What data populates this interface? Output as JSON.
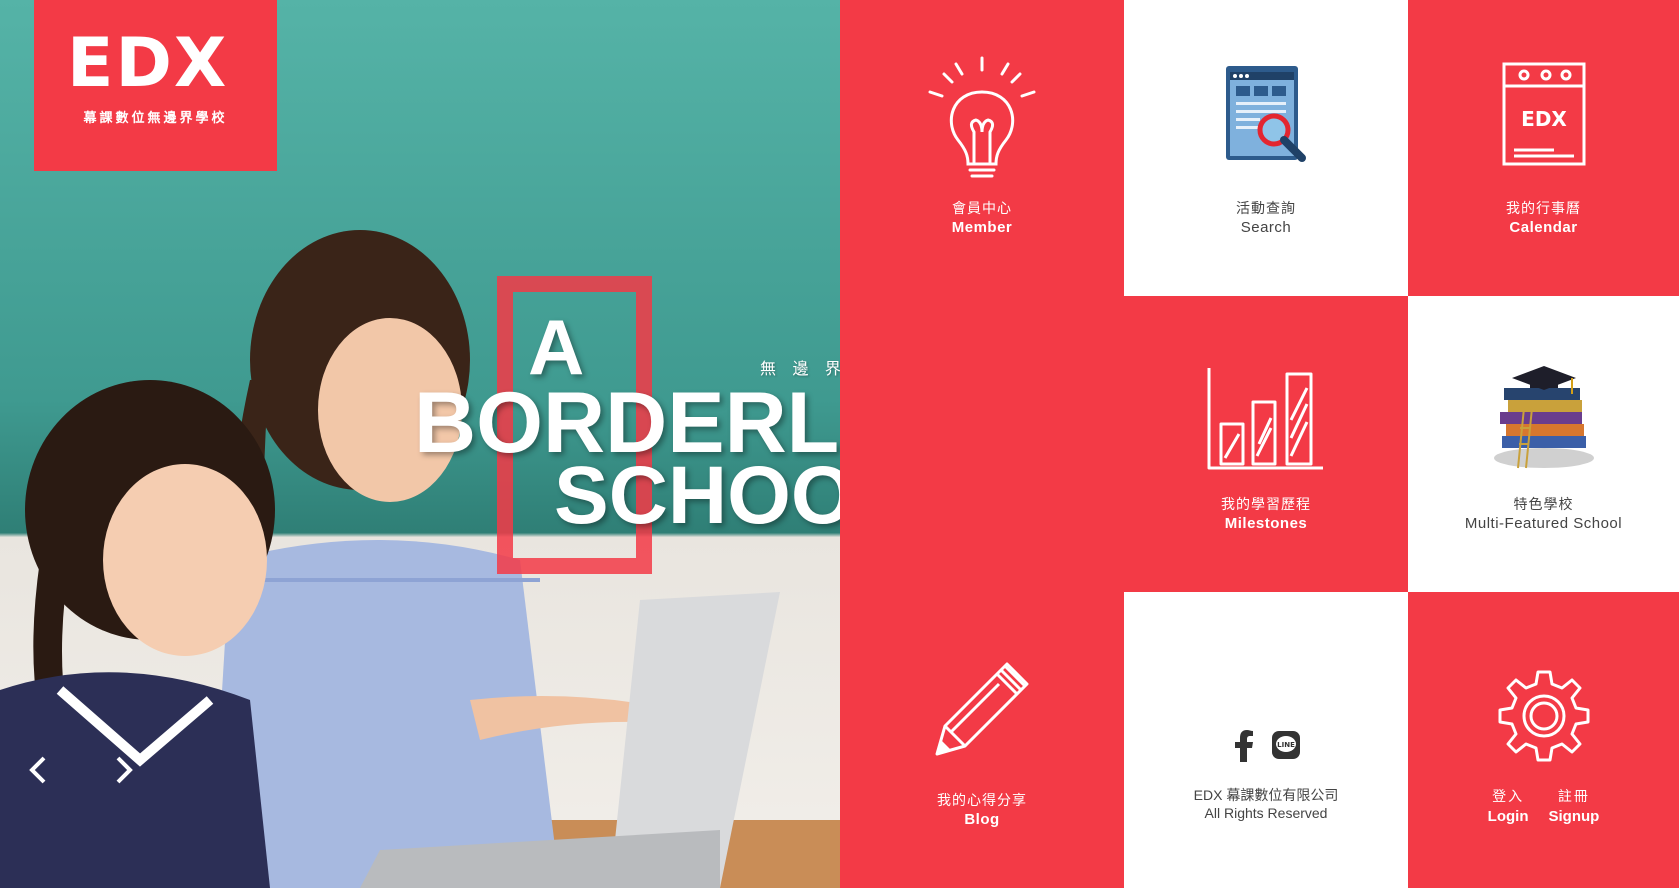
{
  "logo": {
    "brand": "EDX",
    "tagline": "幕課數位無邊界學校"
  },
  "hero": {
    "word1": "A",
    "word2": "BORDERLESS",
    "word3": "SCHOOL",
    "subtitle": "無 邊 界 學 校 · 設 計 未 來",
    "prev_icon": "chevron-left-icon",
    "next_icon": "chevron-right-icon"
  },
  "tiles": {
    "member": {
      "zh": "會員中心",
      "en": "Member",
      "icon": "lightbulb-icon"
    },
    "search": {
      "zh": "活動查詢",
      "en": "Search",
      "icon": "search-document-icon"
    },
    "calendar": {
      "zh": "我的行事曆",
      "en": "Calendar",
      "icon": "calendar-icon",
      "icon_text": "EDX"
    },
    "milestones": {
      "zh": "我的學習歷程",
      "en": "Milestones",
      "icon": "bar-chart-icon"
    },
    "school": {
      "zh": "特色學校",
      "en": "Multi-Featured School",
      "icon": "books-graduation-cap-icon"
    },
    "blog": {
      "zh": "我的心得分享",
      "en": "Blog",
      "icon": "pencil-icon"
    },
    "footer": {
      "line1": "EDX 幕課數位有限公司",
      "line2": "All Rights Reserved",
      "icons": [
        "facebook-icon",
        "line-icon"
      ],
      "line_text": "LINE"
    },
    "login": {
      "login_zh": "登入",
      "login_en": "Login",
      "signup_zh": "註冊",
      "signup_en": "Signup",
      "icon": "gear-icon"
    }
  },
  "colors": {
    "brand_red": "#f33a46",
    "white": "#ffffff",
    "teal": "#4fa99e"
  }
}
